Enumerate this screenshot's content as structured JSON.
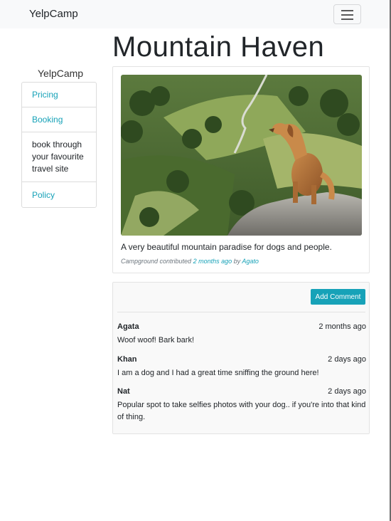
{
  "navbar": {
    "brand": "YelpCamp",
    "toggler_icon": "hamburger-icon"
  },
  "sidebar": {
    "brand": "YelpCamp",
    "items": [
      {
        "label": "Pricing"
      },
      {
        "label": "Booking"
      },
      {
        "label": "book through your favourite travel site"
      },
      {
        "label": "Policy"
      }
    ]
  },
  "campground": {
    "title": "Mountain Haven",
    "image_alt": "Golden retriever standing on a rocky outcrop overlooking green mountain valley",
    "description": "A very beautiful mountain paradise for dogs and people.",
    "contrib_prefix": "Campground contributed",
    "contrib_time": "2 months ago",
    "contrib_by": "by",
    "contrib_author": "Agato"
  },
  "comments_section": {
    "add_button": "Add Comment",
    "comments": [
      {
        "author": "Agata",
        "time": "2 months ago",
        "text": "Woof woof! Bark bark!"
      },
      {
        "author": "Khan",
        "time": "2 days ago",
        "text": "I am a dog and I had a great time sniffing the ground here!"
      },
      {
        "author": "Nat",
        "time": "2 days ago",
        "text": "Popular spot to take selfies photos with your dog.. if you're into that kind of thing."
      }
    ]
  },
  "colors": {
    "accent": "#17a2b8",
    "navbar_bg": "#f8f9fa"
  }
}
